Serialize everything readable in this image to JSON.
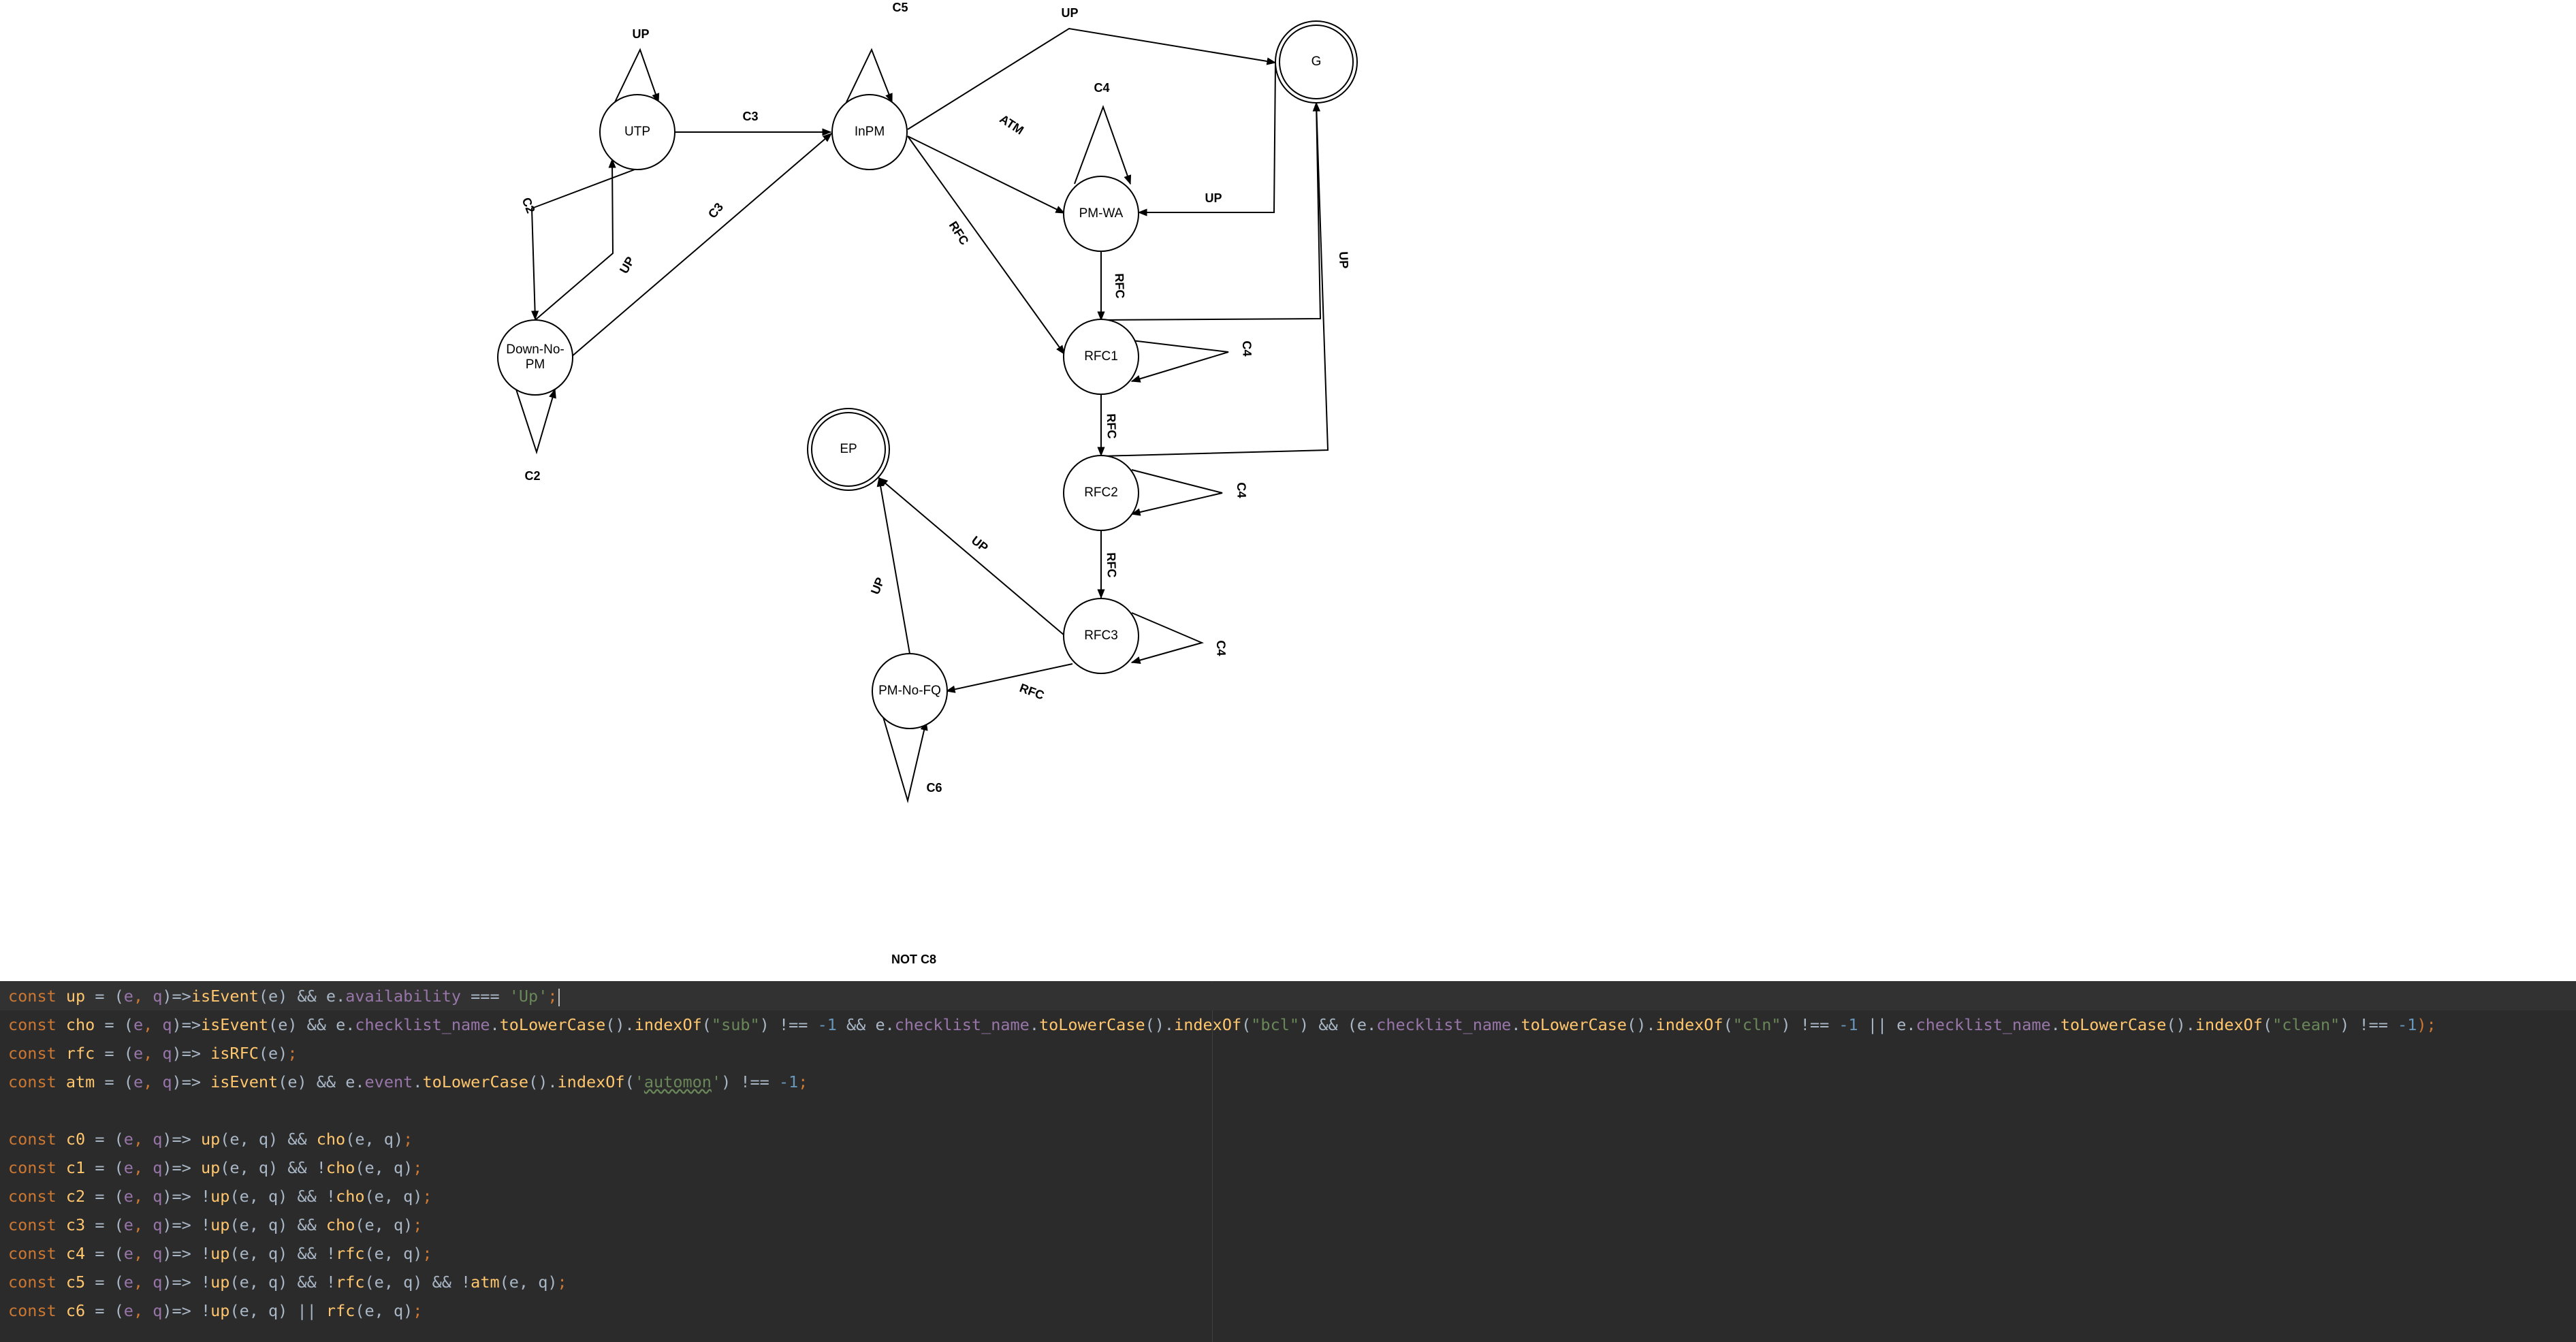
{
  "diagram": {
    "nodes": [
      {
        "id": "UTP",
        "label": "UTP",
        "accepting": false
      },
      {
        "id": "InPM",
        "label": "InPM",
        "accepting": false
      },
      {
        "id": "G",
        "label": "G",
        "accepting": true
      },
      {
        "id": "PM-WA",
        "label": "PM-WA",
        "accepting": false
      },
      {
        "id": "Down-No-PM",
        "label": [
          "Down-No-",
          "PM"
        ],
        "accepting": false
      },
      {
        "id": "RFC1",
        "label": "RFC1",
        "accepting": false
      },
      {
        "id": "EP",
        "label": "EP",
        "accepting": true
      },
      {
        "id": "RFC2",
        "label": "RFC2",
        "accepting": false
      },
      {
        "id": "RFC3",
        "label": "RFC3",
        "accepting": false
      },
      {
        "id": "PM-No-FQ",
        "label": "PM-No-FQ",
        "accepting": false
      }
    ],
    "edges": [
      {
        "from": "UTP",
        "to": "UTP",
        "label": "UP"
      },
      {
        "from": "InPM",
        "to": "InPM",
        "label": "C5"
      },
      {
        "from": "UTP",
        "to": "InPM",
        "label": "C3"
      },
      {
        "from": "InPM",
        "to": "G",
        "label": "UP"
      },
      {
        "from": "InPM",
        "to": "PM-WA",
        "label": "ATM"
      },
      {
        "from": "PM-WA",
        "to": "PM-WA",
        "label": "C4"
      },
      {
        "from": "G",
        "to": "PM-WA",
        "label": "UP"
      },
      {
        "from": "UTP",
        "to": "Down-No-PM",
        "label": "C2"
      },
      {
        "from": "Down-No-PM",
        "to": "UTP",
        "label": "UP"
      },
      {
        "from": "Down-No-PM",
        "to": "InPM",
        "label": "C3"
      },
      {
        "from": "InPM",
        "to": "RFC1",
        "label": "RFC"
      },
      {
        "from": "PM-WA",
        "to": "RFC1",
        "label": "RFC"
      },
      {
        "from": "RFC1",
        "to": "G",
        "label": "UP"
      },
      {
        "from": "RFC2",
        "to": "G",
        "label": ""
      },
      {
        "from": "Down-No-PM",
        "to": "Down-No-PM",
        "label": "C2"
      },
      {
        "from": "RFC1",
        "to": "RFC1",
        "label": "C4"
      },
      {
        "from": "RFC1",
        "to": "RFC2",
        "label": "RFC"
      },
      {
        "from": "RFC2",
        "to": "RFC2",
        "label": "C4"
      },
      {
        "from": "RFC2",
        "to": "RFC3",
        "label": "RFC"
      },
      {
        "from": "RFC3",
        "to": "RFC3",
        "label": "C4"
      },
      {
        "from": "RFC3",
        "to": "EP",
        "label": "UP"
      },
      {
        "from": "PM-No-FQ",
        "to": "EP",
        "label": "UP"
      },
      {
        "from": "RFC3",
        "to": "PM-No-FQ",
        "label": "RFC"
      },
      {
        "from": "PM-No-FQ",
        "to": "PM-No-FQ",
        "label": "C6"
      }
    ],
    "extra_labels": [
      "NOT C8"
    ]
  },
  "editor": {
    "lines": [
      [
        [
          "const ",
          "keyword"
        ],
        [
          "up",
          "decl"
        ],
        [
          " = (",
          "plain"
        ],
        [
          "e",
          "param"
        ],
        [
          ", ",
          "punct"
        ],
        [
          "q",
          "param"
        ],
        [
          ")=>",
          "plain"
        ],
        [
          "isEvent",
          "func"
        ],
        [
          "(e) && e.",
          "plain"
        ],
        [
          "availability",
          "prop"
        ],
        [
          " === ",
          "plain"
        ],
        [
          "'Up'",
          "string"
        ],
        [
          ";",
          "punct"
        ]
      ],
      [
        [
          "const ",
          "keyword"
        ],
        [
          "cho",
          "decl"
        ],
        [
          " = (",
          "plain"
        ],
        [
          "e",
          "param"
        ],
        [
          ", ",
          "punct"
        ],
        [
          "q",
          "param"
        ],
        [
          ")=>",
          "plain"
        ],
        [
          "isEvent",
          "func"
        ],
        [
          "(e) && e.",
          "plain"
        ],
        [
          "checklist_name",
          "prop"
        ],
        [
          ".",
          "plain"
        ],
        [
          "toLowerCase",
          "func"
        ],
        [
          "().",
          "plain"
        ],
        [
          "indexOf",
          "func"
        ],
        [
          "(",
          "plain"
        ],
        [
          "\"sub\"",
          "string"
        ],
        [
          ") !== ",
          "plain"
        ],
        [
          "-1",
          "number"
        ],
        [
          " && e.",
          "plain"
        ],
        [
          "checklist_name",
          "prop"
        ],
        [
          ".",
          "plain"
        ],
        [
          "toLowerCase",
          "func"
        ],
        [
          "().",
          "plain"
        ],
        [
          "indexOf",
          "func"
        ],
        [
          "(",
          "plain"
        ],
        [
          "\"bcl\"",
          "string"
        ],
        [
          ") && (e.",
          "plain"
        ],
        [
          "checklist_name",
          "prop"
        ],
        [
          ".",
          "plain"
        ],
        [
          "toLowerCase",
          "func"
        ],
        [
          "().",
          "plain"
        ],
        [
          "indexOf",
          "func"
        ],
        [
          "(",
          "plain"
        ],
        [
          "\"cln\"",
          "string"
        ],
        [
          ") !== ",
          "plain"
        ],
        [
          "-1",
          "number"
        ],
        [
          " || e.",
          "plain"
        ],
        [
          "checklist_name",
          "prop"
        ],
        [
          ".",
          "plain"
        ],
        [
          "toLowerCase",
          "func"
        ],
        [
          "().",
          "plain"
        ],
        [
          "indexOf",
          "func"
        ],
        [
          "(",
          "plain"
        ],
        [
          "\"clean\"",
          "string"
        ],
        [
          ") !== ",
          "plain"
        ],
        [
          "-1",
          "number"
        ],
        [
          ");",
          "punct"
        ]
      ],
      [
        [
          "const ",
          "keyword"
        ],
        [
          "rfc",
          "decl"
        ],
        [
          " = (",
          "plain"
        ],
        [
          "e",
          "param"
        ],
        [
          ", ",
          "punct"
        ],
        [
          "q",
          "param"
        ],
        [
          ")=> ",
          "plain"
        ],
        [
          "isRFC",
          "func"
        ],
        [
          "(e)",
          "plain"
        ],
        [
          ";",
          "punct"
        ]
      ],
      [
        [
          "const ",
          "keyword"
        ],
        [
          "atm",
          "decl"
        ],
        [
          " = (",
          "plain"
        ],
        [
          "e",
          "param"
        ],
        [
          ", ",
          "punct"
        ],
        [
          "q",
          "param"
        ],
        [
          ")=> ",
          "plain"
        ],
        [
          "isEvent",
          "func"
        ],
        [
          "(e) && e.",
          "plain"
        ],
        [
          "event",
          "prop"
        ],
        [
          ".",
          "plain"
        ],
        [
          "toLowerCase",
          "func"
        ],
        [
          "().",
          "plain"
        ],
        [
          "indexOf",
          "func"
        ],
        [
          "(",
          "plain"
        ],
        [
          "'",
          "string"
        ],
        [
          "automon",
          "string-underline"
        ],
        [
          "'",
          "string"
        ],
        [
          ") !== ",
          "plain"
        ],
        [
          "-1",
          "number"
        ],
        [
          ";",
          "punct"
        ]
      ],
      [],
      [
        [
          "const ",
          "keyword"
        ],
        [
          "c0",
          "decl"
        ],
        [
          " = (",
          "plain"
        ],
        [
          "e",
          "param"
        ],
        [
          ", ",
          "punct"
        ],
        [
          "q",
          "param"
        ],
        [
          ")=> ",
          "plain"
        ],
        [
          "up",
          "func"
        ],
        [
          "(e, q) && ",
          "plain"
        ],
        [
          "cho",
          "func"
        ],
        [
          "(e, q)",
          "plain"
        ],
        [
          ";",
          "punct"
        ]
      ],
      [
        [
          "const ",
          "keyword"
        ],
        [
          "c1",
          "decl"
        ],
        [
          " = (",
          "plain"
        ],
        [
          "e",
          "param"
        ],
        [
          ", ",
          "punct"
        ],
        [
          "q",
          "param"
        ],
        [
          ")=> ",
          "plain"
        ],
        [
          "up",
          "func"
        ],
        [
          "(e, q) && !",
          "plain"
        ],
        [
          "cho",
          "func"
        ],
        [
          "(e, q)",
          "plain"
        ],
        [
          ";",
          "punct"
        ]
      ],
      [
        [
          "const ",
          "keyword"
        ],
        [
          "c2",
          "decl"
        ],
        [
          " = (",
          "plain"
        ],
        [
          "e",
          "param"
        ],
        [
          ", ",
          "punct"
        ],
        [
          "q",
          "param"
        ],
        [
          ")=> !",
          "plain"
        ],
        [
          "up",
          "func"
        ],
        [
          "(e, q) && !",
          "plain"
        ],
        [
          "cho",
          "func"
        ],
        [
          "(e, q)",
          "plain"
        ],
        [
          ";",
          "punct"
        ]
      ],
      [
        [
          "const ",
          "keyword"
        ],
        [
          "c3",
          "decl"
        ],
        [
          " = (",
          "plain"
        ],
        [
          "e",
          "param"
        ],
        [
          ", ",
          "punct"
        ],
        [
          "q",
          "param"
        ],
        [
          ")=> !",
          "plain"
        ],
        [
          "up",
          "func"
        ],
        [
          "(e, q) && ",
          "plain"
        ],
        [
          "cho",
          "func"
        ],
        [
          "(e, q)",
          "plain"
        ],
        [
          ";",
          "punct"
        ]
      ],
      [
        [
          "const ",
          "keyword"
        ],
        [
          "c4",
          "decl"
        ],
        [
          " = (",
          "plain"
        ],
        [
          "e",
          "param"
        ],
        [
          ", ",
          "punct"
        ],
        [
          "q",
          "param"
        ],
        [
          ")=> !",
          "plain"
        ],
        [
          "up",
          "func"
        ],
        [
          "(e, q) && !",
          "plain"
        ],
        [
          "rfc",
          "func"
        ],
        [
          "(e, q)",
          "plain"
        ],
        [
          ";",
          "punct"
        ]
      ],
      [
        [
          "const ",
          "keyword"
        ],
        [
          "c5",
          "decl"
        ],
        [
          " = (",
          "plain"
        ],
        [
          "e",
          "param"
        ],
        [
          ", ",
          "punct"
        ],
        [
          "q",
          "param"
        ],
        [
          ")=> !",
          "plain"
        ],
        [
          "up",
          "func"
        ],
        [
          "(e, q) && !",
          "plain"
        ],
        [
          "rfc",
          "func"
        ],
        [
          "(e, q) && !",
          "plain"
        ],
        [
          "atm",
          "func"
        ],
        [
          "(e, q)",
          "plain"
        ],
        [
          ";",
          "punct"
        ]
      ],
      [
        [
          "const ",
          "keyword"
        ],
        [
          "c6",
          "decl"
        ],
        [
          " = (",
          "plain"
        ],
        [
          "e",
          "param"
        ],
        [
          ", ",
          "punct"
        ],
        [
          "q",
          "param"
        ],
        [
          ")=> !",
          "plain"
        ],
        [
          "up",
          "func"
        ],
        [
          "(e, q) || ",
          "plain"
        ],
        [
          "rfc",
          "func"
        ],
        [
          "(e, q)",
          "plain"
        ],
        [
          ";",
          "punct"
        ]
      ]
    ]
  }
}
